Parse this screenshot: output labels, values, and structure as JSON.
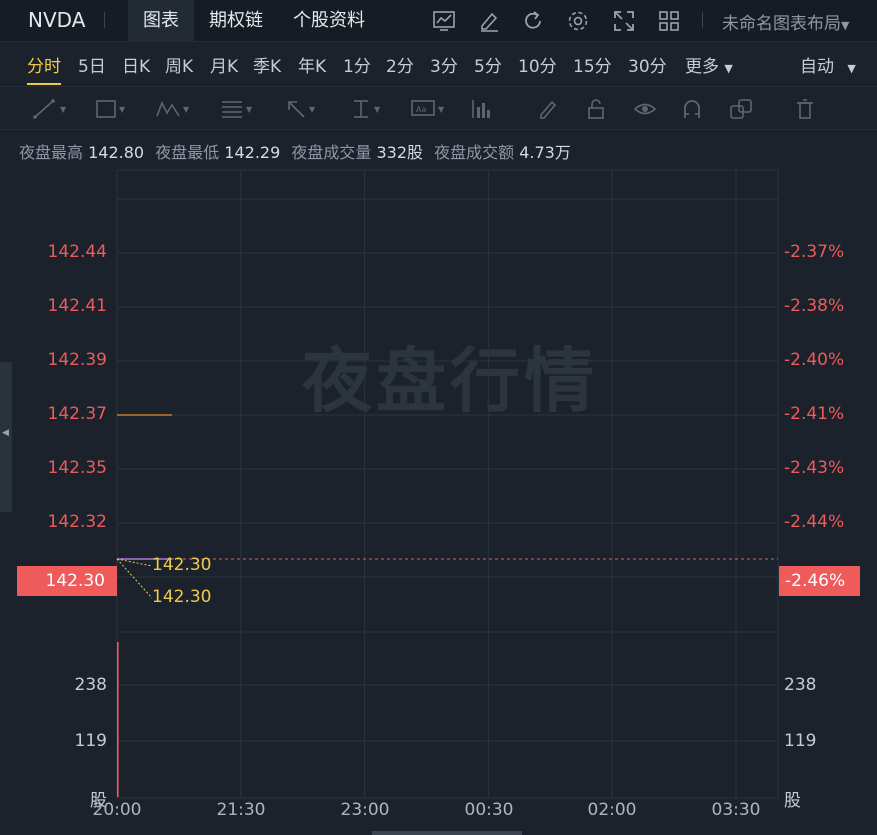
{
  "header": {
    "symbol": "NVDA",
    "tabs": [
      {
        "label": "图表",
        "active": true
      },
      {
        "label": "期权链",
        "active": false
      },
      {
        "label": "个股资料",
        "active": false
      }
    ],
    "icons": [
      "chart-template-icon",
      "edit-icon",
      "refresh-icon",
      "settings-icon",
      "fullscreen-icon",
      "layout-grid-icon"
    ],
    "layout_label": "未命名图表布局"
  },
  "periods": {
    "items": [
      "分时",
      "5日",
      "日K",
      "周K",
      "月K",
      "季K",
      "年K",
      "1分",
      "2分",
      "3分",
      "5分",
      "10分",
      "15分",
      "30分",
      "更多"
    ],
    "active": "分时",
    "mode": "自动"
  },
  "info": {
    "high_label": "夜盘最高",
    "high": "142.80",
    "low_label": "夜盘最低",
    "low": "142.29",
    "volume_label": "夜盘成交量",
    "volume": "332股",
    "amount_label": "夜盘成交额",
    "amount": "4.73万"
  },
  "chart_data": {
    "type": "line",
    "watermark": "夜盘行情",
    "price_ticks": [
      "142.44",
      "142.41",
      "142.39",
      "142.37",
      "142.35",
      "142.32"
    ],
    "percent_ticks": [
      "-2.37%",
      "-2.38%",
      "-2.40%",
      "-2.41%",
      "-2.43%",
      "-2.44%"
    ],
    "tick_values": [
      142.44,
      142.41,
      142.39,
      142.37,
      142.35,
      142.32
    ],
    "current_price": "142.30",
    "current_percent": "-2.46%",
    "callout_high": "142.30",
    "callout_low": "142.30",
    "x_ticks": [
      "20:00",
      "21:30",
      "23:00",
      "00:30",
      "02:00",
      "03:30"
    ],
    "price_series": [
      {
        "name": "price",
        "color": "#c9782c",
        "x": [
          "20:00",
          "20:40"
        ],
        "y": [
          142.37,
          142.37
        ]
      },
      {
        "name": "avg",
        "color": "#b07bd8",
        "x": [
          "20:00",
          "20:40"
        ],
        "y": [
          142.3,
          142.3
        ]
      }
    ],
    "volume_ticks": [
      "238",
      "119"
    ],
    "volume_unit": "股",
    "volume_bars": [
      {
        "x": "20:00",
        "value": 332
      }
    ],
    "colors": {
      "up": "#ef5a5a",
      "accent": "#f2c94c",
      "grid": "#2b343f"
    }
  }
}
